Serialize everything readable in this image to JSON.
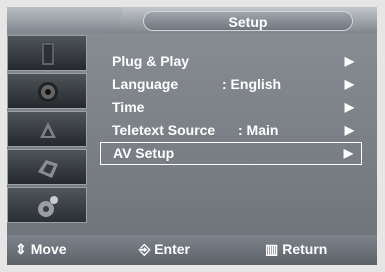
{
  "header": {
    "title": "Setup"
  },
  "sidebar": {
    "items": [
      {
        "icon": "tv-icon"
      },
      {
        "icon": "speaker-icon"
      },
      {
        "icon": "satellite-icon"
      },
      {
        "icon": "channel-icon"
      },
      {
        "icon": "setup-icon"
      }
    ]
  },
  "menu": {
    "items": [
      {
        "label": "Plug & Play",
        "value": "",
        "arrow": "▶"
      },
      {
        "label": "Language",
        "value": ": English",
        "arrow": "▶"
      },
      {
        "label": "Time",
        "value": "",
        "arrow": "▶"
      },
      {
        "label": "Teletext Source",
        "value": ": Main",
        "arrow": "▶"
      },
      {
        "label": "AV Setup",
        "value": "",
        "arrow": "▶",
        "selected": true
      }
    ]
  },
  "footer": {
    "move_label": "Move",
    "enter_label": "Enter",
    "return_label": "Return",
    "move_icon": "updown-icon",
    "enter_icon": "enter-icon",
    "return_icon": "menu-icon"
  },
  "colors": {
    "panel": "#6d7278",
    "text": "#ffffff",
    "tile": "#2a2f33"
  }
}
